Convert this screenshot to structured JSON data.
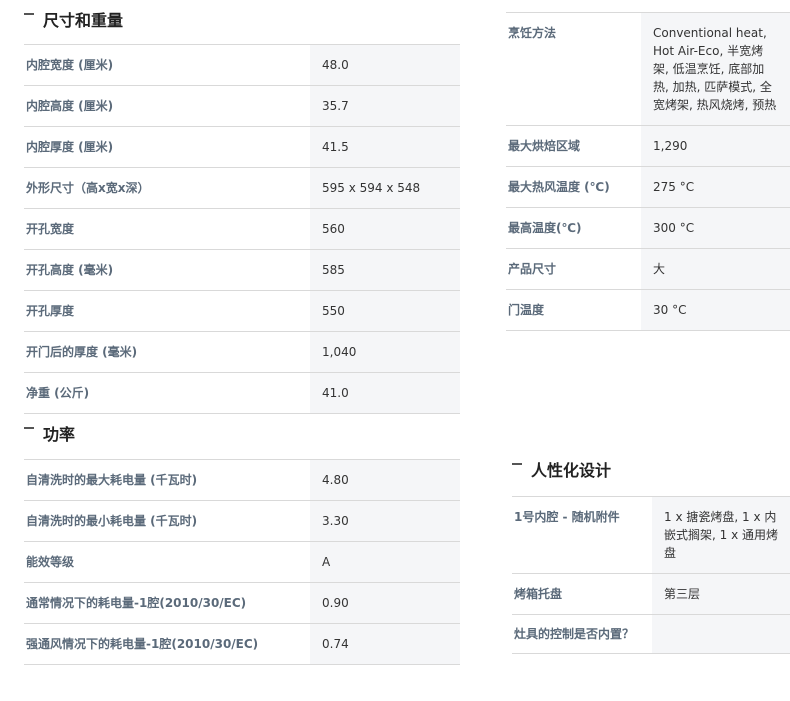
{
  "dimensions": {
    "title": "尺寸和重量",
    "rows": [
      {
        "label": "内腔宽度 (厘米)",
        "value": "48.0"
      },
      {
        "label": "内腔高度 (厘米)",
        "value": "35.7"
      },
      {
        "label": "内腔厚度 (厘米)",
        "value": "41.5"
      },
      {
        "label": "外形尺寸（高x宽x深）",
        "value": "595 x 594 x 548"
      },
      {
        "label": "开孔宽度",
        "value": "560"
      },
      {
        "label": "开孔高度 (毫米)",
        "value": "585"
      },
      {
        "label": "开孔厚度",
        "value": "550"
      },
      {
        "label": "开门后的厚度 (毫米)",
        "value": "1,040"
      },
      {
        "label": "净重 (公斤)",
        "value": "41.0"
      }
    ]
  },
  "power": {
    "title": "功率",
    "rows": [
      {
        "label": "自清洗时的最大耗电量 (千瓦时)",
        "value": "4.80"
      },
      {
        "label": "自清洗时的最小耗电量 (千瓦时)",
        "value": "3.30"
      },
      {
        "label": "能效等级",
        "value": "A"
      },
      {
        "label": "通常情况下的耗电量-1腔(2010/30/EC)",
        "value": "0.90"
      },
      {
        "label": "强通风情况下的耗电量-1腔(2010/30/EC)",
        "value": "0.74"
      }
    ]
  },
  "cooking": {
    "rows": [
      {
        "label": "烹饪方法",
        "value": "Conventional heat, Hot Air-Eco, 半宽烤架, 低温烹饪, 底部加热, 加热, 匹萨模式, 全宽烤架, 热风烧烤, 预热"
      },
      {
        "label": "最大烘焙区域",
        "value": "1,290"
      },
      {
        "label": "最大热风温度 (℃)",
        "value": "275 °C"
      },
      {
        "label": "最高温度(℃)",
        "value": "300 °C"
      },
      {
        "label": "产品尺寸",
        "value": "大"
      },
      {
        "label": "门温度",
        "value": "30 °C"
      }
    ]
  },
  "humanized": {
    "title": "人性化设计",
    "rows": [
      {
        "label": "1号内腔 - 随机附件",
        "value": "1 x 搪瓷烤盘, 1 x 内嵌式搁架, 1 x 通用烤盘"
      },
      {
        "label": "烤箱托盘",
        "value": "第三层"
      },
      {
        "label": "灶具的控制是否内置？",
        "value": ""
      }
    ]
  }
}
